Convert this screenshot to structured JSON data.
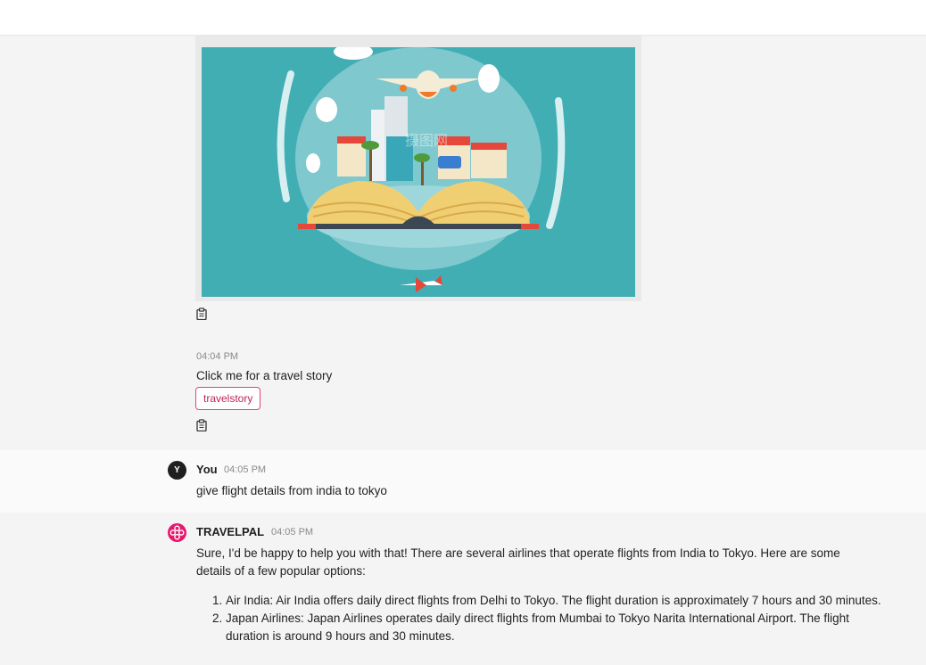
{
  "bot1": {
    "time": "04:04 PM",
    "message": "Click me for a travel story",
    "chip_label": "travelstory",
    "watermark": "摄图网"
  },
  "user": {
    "avatar_letter": "Y",
    "name": "You",
    "time": "04:05 PM",
    "message": "give flight details from india to tokyo"
  },
  "bot2": {
    "name": "TRAVELPAL",
    "time": "04:05 PM",
    "intro": "Sure, I'd be happy to help you with that! There are several airlines that operate flights from India to Tokyo. Here are some details of a few popular options:",
    "options": [
      "Air India: Air India offers daily direct flights from Delhi to Tokyo. The flight duration is approximately 7 hours and 30 minutes.",
      "Japan Airlines: Japan Airlines operates daily direct flights from Mumbai to Tokyo Narita International Airport. The flight duration is around 9 hours and 30 minutes."
    ]
  },
  "colors": {
    "accent": "#e0457b",
    "teal": "#41aeb4"
  },
  "icons": {
    "copy": "clipboard-icon",
    "bot_logo": "travelpal-logo-icon"
  }
}
